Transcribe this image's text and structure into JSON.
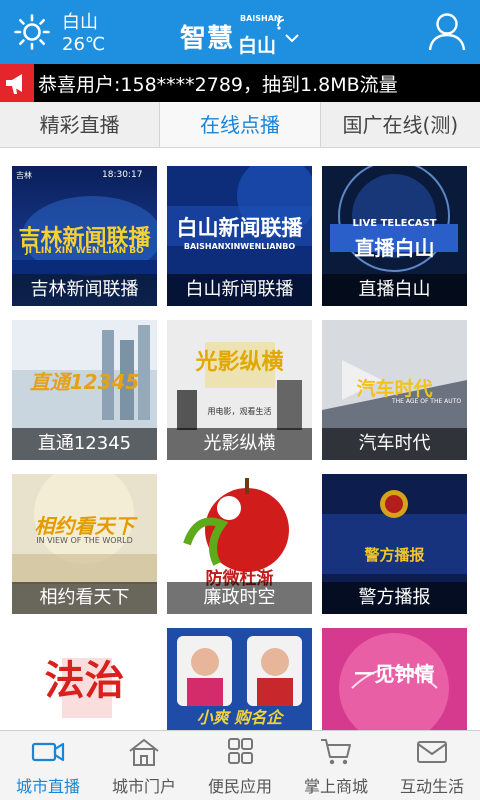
{
  "header": {
    "city": "白山",
    "temperature": "26℃",
    "brand_main": "智慧",
    "brand_sub": "白山",
    "brand_tiny": "BAISHAN"
  },
  "notice": {
    "text": "恭喜用户:158****2789，抽到1.8MB流量"
  },
  "tabs": [
    {
      "label": "精彩直播"
    },
    {
      "label": "在线点播"
    },
    {
      "label": "国广在线(测)"
    }
  ],
  "tiles": [
    {
      "label": "吉林新闻联播",
      "title": "吉林新闻联播",
      "subtitle": "JI LIN XIN WEN LIAN BO",
      "badge": "吉林",
      "time": "18:30:17"
    },
    {
      "label": "白山新闻联播",
      "title": "白山新闻联播",
      "subtitle": "BAISHANXINWENLIANBO"
    },
    {
      "label": "直播白山",
      "title": "直播白山",
      "subtitle": "LIVE TELECAST"
    },
    {
      "label": "直通12345",
      "title": "直通12345"
    },
    {
      "label": "光影纵横",
      "title": "光影纵横",
      "subtitle": "用电影，观看生活"
    },
    {
      "label": "汽车时代",
      "title": "汽车时代",
      "subtitle": "THE AGE OF THE AUTO"
    },
    {
      "label": "相约看天下",
      "title": "相约看天下",
      "subtitle": "IN VIEW OF THE WORLD"
    },
    {
      "label": "廉政时空",
      "title": "防微杜渐"
    },
    {
      "label": "警方播报",
      "title": "警方播报"
    },
    {
      "label": "",
      "title": "法治"
    },
    {
      "label": "",
      "title": "小爽 购名企"
    },
    {
      "label": "",
      "title": "一见钟情"
    }
  ],
  "bottom_nav": [
    {
      "label": "城市直播",
      "icon": "video-camera-icon"
    },
    {
      "label": "城市门户",
      "icon": "home-icon"
    },
    {
      "label": "便民应用",
      "icon": "apps-grid-icon"
    },
    {
      "label": "掌上商城",
      "icon": "cart-icon"
    },
    {
      "label": "互动生活",
      "icon": "mail-icon"
    }
  ],
  "colors": {
    "header_bg": "#1f8fe0",
    "accent": "#1a84d6",
    "notice_red": "#e4252b"
  }
}
